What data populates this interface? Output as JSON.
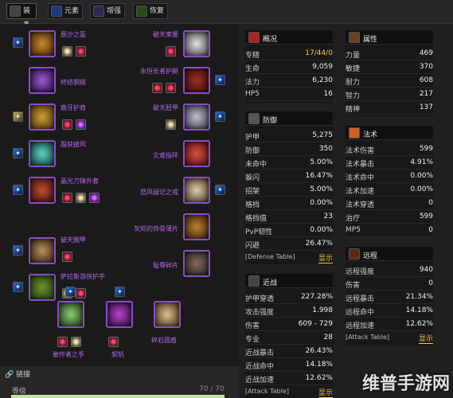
{
  "tabs": [
    {
      "label": "装备",
      "active": true,
      "icon": "helm-icon"
    },
    {
      "label": "元素",
      "active": false,
      "icon": "lightning-icon"
    },
    {
      "label": "增强",
      "active": false,
      "icon": "shield-icon"
    },
    {
      "label": "恢复",
      "active": false,
      "icon": "nature-icon"
    }
  ],
  "equipment": {
    "left": [
      {
        "name": "辰沙之盔"
      },
      {
        "name": "终结钢链"
      },
      {
        "name": "鹿牙护肩"
      },
      {
        "name": "殷获披风"
      },
      {
        "name": "晶光刀锋外套"
      },
      {
        "name": "破天腕甲"
      },
      {
        "name": "萨拉斯游侠护手"
      }
    ],
    "right": [
      {
        "name": "破天束腰"
      },
      {
        "name": "永恒长者护腿"
      },
      {
        "name": "破天胫甲"
      },
      {
        "name": "灾难指环"
      },
      {
        "name": "怒风疑记之戒"
      },
      {
        "name": "灰烬的饰骨薄片"
      },
      {
        "name": "耻辱碎片"
      }
    ],
    "weapons": [
      {
        "name": "敢作者之手"
      },
      {
        "name": "契钒"
      },
      {
        "name": "碎石圆盾"
      }
    ]
  },
  "link": {
    "title": "链接",
    "level_label": "等级",
    "level_value": "70 / 70",
    "level_fraction": 1.0
  },
  "overview": {
    "title": "概况",
    "rows": [
      {
        "k": "专精",
        "v": "17/44/0",
        "yellow": true
      },
      {
        "k": "生命",
        "v": "9,059"
      },
      {
        "k": "法力",
        "v": "6,230"
      },
      {
        "k": "HP5",
        "v": "16"
      }
    ]
  },
  "attributes": {
    "title": "属性",
    "rows": [
      {
        "k": "力量",
        "v": "469"
      },
      {
        "k": "敏捷",
        "v": "370"
      },
      {
        "k": "耐力",
        "v": "608"
      },
      {
        "k": "智力",
        "v": "217"
      },
      {
        "k": "精神",
        "v": "137"
      }
    ]
  },
  "defense": {
    "title": "防御",
    "rows": [
      {
        "k": "护甲",
        "v": "5,275"
      },
      {
        "k": "防御",
        "v": "350"
      },
      {
        "k": "未命中",
        "v": "5.00%"
      },
      {
        "k": "躲闪",
        "v": "16.47%"
      },
      {
        "k": "招架",
        "v": "5.00%"
      },
      {
        "k": "格挡",
        "v": "0.00%"
      },
      {
        "k": "格挡值",
        "v": "23"
      },
      {
        "k": "PvP韧性",
        "v": "0.00%"
      },
      {
        "k": "闪避",
        "v": "26.47%"
      }
    ],
    "table_label": "[Defense Table]",
    "table_btn": "显示"
  },
  "spell": {
    "title": "法术",
    "rows": [
      {
        "k": "法术伤害",
        "v": "599"
      },
      {
        "k": "法术暴击",
        "v": "4.91%"
      },
      {
        "k": "法术命中",
        "v": "0.00%"
      },
      {
        "k": "法术加速",
        "v": "0.00%"
      },
      {
        "k": "法术穿透",
        "v": "0"
      },
      {
        "k": "治疗",
        "v": "599"
      },
      {
        "k": "MP5",
        "v": "0"
      }
    ]
  },
  "melee": {
    "title": "近战",
    "rows": [
      {
        "k": "护甲穿透",
        "v": "227.28%"
      },
      {
        "k": "攻击强度",
        "v": "1.998"
      },
      {
        "k": "伤害",
        "v": "609 - 729"
      },
      {
        "k": "专业",
        "v": "28"
      },
      {
        "k": "近战暴击",
        "v": "26.43%"
      },
      {
        "k": "近战命中",
        "v": "14.18%"
      },
      {
        "k": "近战加速",
        "v": "12.62%"
      }
    ],
    "table_label": "[Attack Table]",
    "table_btn": "显示"
  },
  "ranged": {
    "title": "远程",
    "rows": [
      {
        "k": "远程强度",
        "v": "940"
      },
      {
        "k": "伤害",
        "v": "0"
      },
      {
        "k": "远程暴击",
        "v": "21.34%"
      },
      {
        "k": "远程命中",
        "v": "14.18%"
      },
      {
        "k": "远程加速",
        "v": "12.62%"
      }
    ],
    "table_label": "[Attack Table]",
    "table_btn": "显示"
  },
  "watermark": "维普手游网",
  "colors": {
    "epic": "#b66cf0",
    "accent": "#f4c94a",
    "bg": "#1f1f1f"
  }
}
